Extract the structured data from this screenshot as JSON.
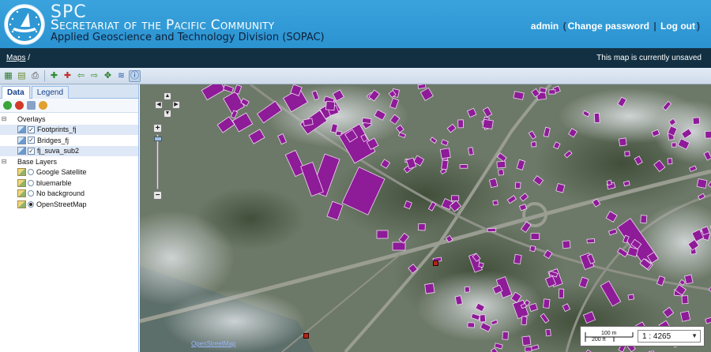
{
  "header": {
    "org_abbr": "SPC",
    "org_name": "Secretariat of the Pacific Community",
    "division": "Applied Geoscience and Technology Division (SOPAC)",
    "user": "admin",
    "change_password": "Change password",
    "logout": "Log out",
    "bg_color": "#3399d6"
  },
  "breadcrumb": {
    "maps_link": "Maps",
    "separator": "/",
    "status": "This map is currently unsaved"
  },
  "toolbar": {
    "icons": [
      "zoom-to-max-extent-icon",
      "layer-properties-icon",
      "print-icon",
      "zoom-in-icon",
      "zoom-out-icon",
      "back-icon",
      "forward-icon",
      "pan-icon",
      "measure-icon",
      "info-icon"
    ]
  },
  "panel": {
    "tabs": [
      {
        "label": "Data",
        "active": true
      },
      {
        "label": "Legend",
        "active": false
      }
    ],
    "tree": {
      "overlays_label": "Overlays",
      "overlays": [
        {
          "label": "Footprints_fj",
          "checked": true
        },
        {
          "label": "Bridges_fj",
          "checked": true
        },
        {
          "label": "fj_suva_sub2",
          "checked": true
        }
      ],
      "base_label": "Base Layers",
      "base_layers": [
        {
          "label": "Google Satellite",
          "selected": false
        },
        {
          "label": "bluemarble",
          "selected": false
        },
        {
          "label": "No background",
          "selected": false
        },
        {
          "label": "OpenStreetMap",
          "selected": true
        }
      ]
    }
  },
  "map": {
    "footprint_color": "#8e1b97",
    "attribution": "OpenStreetMap",
    "scale_top": "100 m",
    "scale_bottom": "200 ft",
    "scale_value": "1 : 4265"
  }
}
